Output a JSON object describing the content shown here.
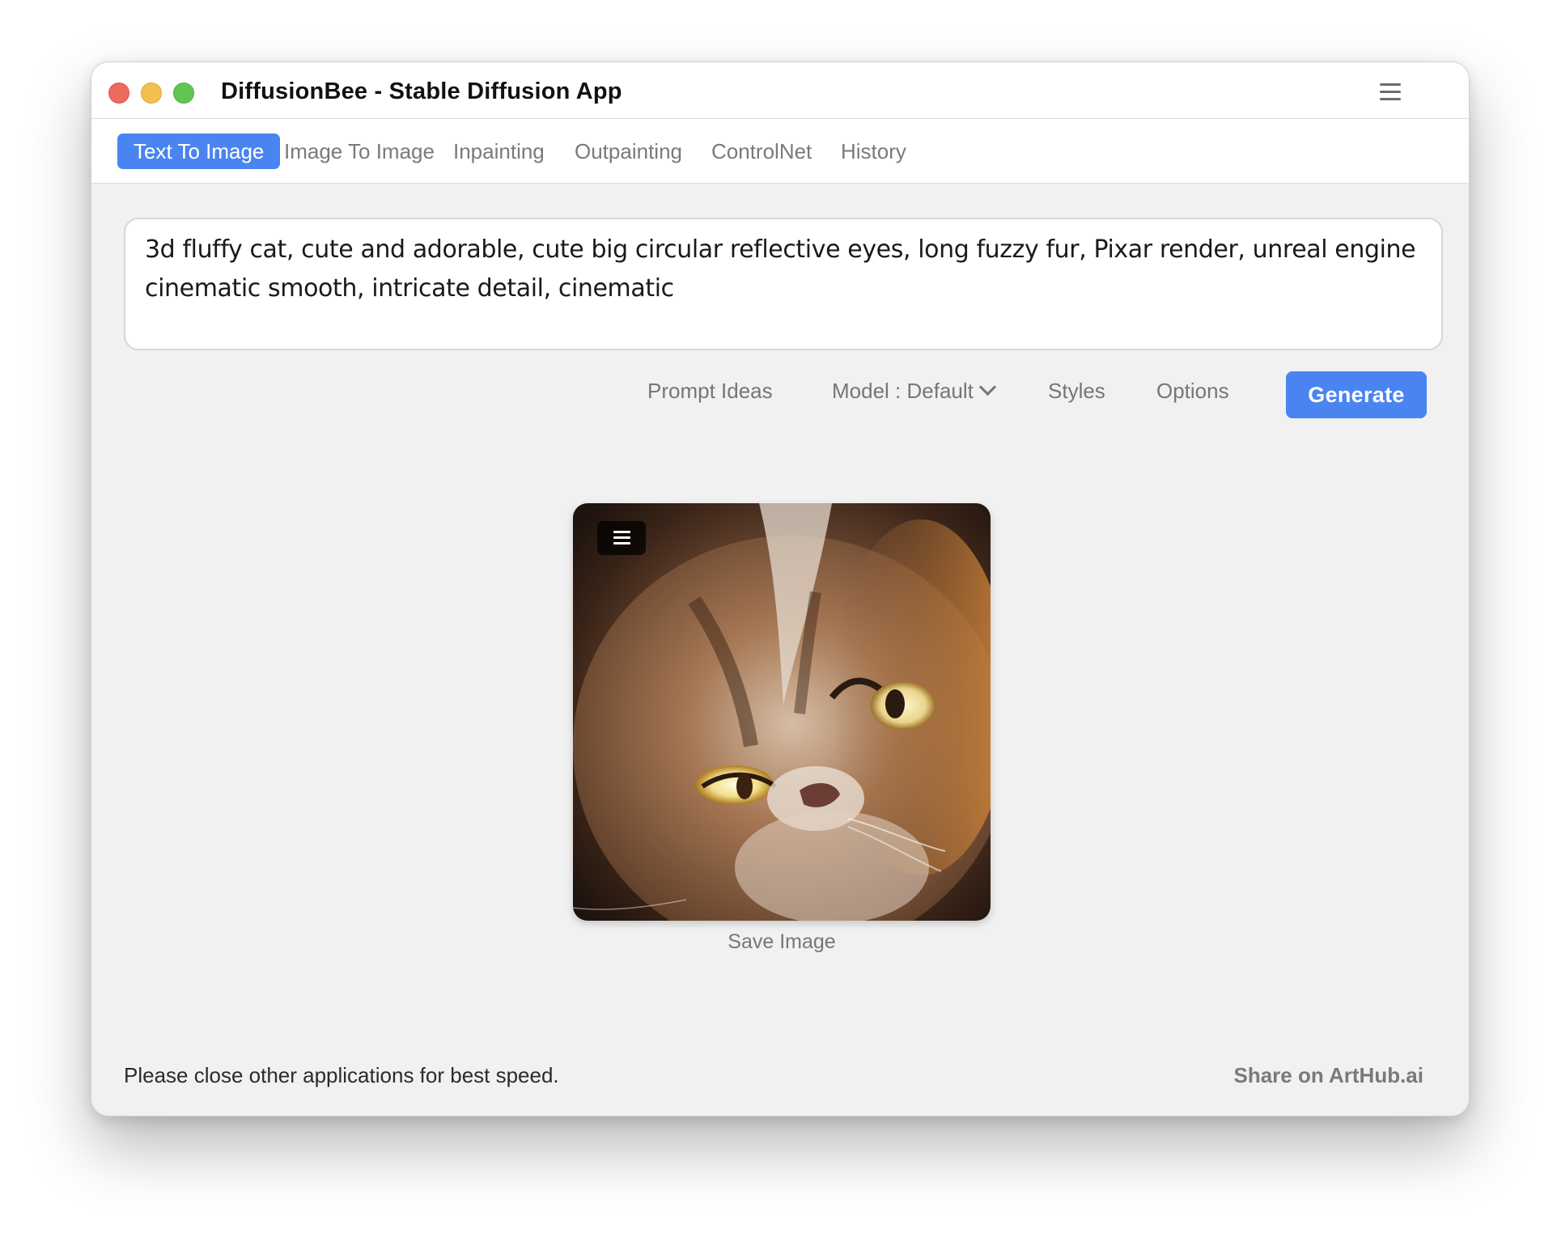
{
  "window": {
    "title": "DiffusionBee - Stable Diffusion App",
    "menu_icon": "hamburger-menu-icon"
  },
  "tabs": [
    {
      "label": "Text To Image",
      "active": true
    },
    {
      "label": "Image To Image",
      "active": false
    },
    {
      "label": "Inpainting",
      "active": false
    },
    {
      "label": "Outpainting",
      "active": false
    },
    {
      "label": "ControlNet",
      "active": false
    },
    {
      "label": "History",
      "active": false
    }
  ],
  "prompt": {
    "value": "3d fluffy cat, cute and adorable, cute big circular reflective eyes, long fuzzy fur, Pixar render, unreal engine cinematic smooth, intricate detail, cinematic"
  },
  "toolbar": {
    "prompt_ideas": "Prompt Ideas",
    "model": "Model : Default",
    "styles": "Styles",
    "options": "Options",
    "generate": "Generate"
  },
  "result": {
    "image_menu_icon": "hamburger-menu-icon",
    "save_label": "Save Image"
  },
  "footer": {
    "status": "Please close other applications for best speed.",
    "share": "Share on ArtHub.ai"
  },
  "colors": {
    "accent": "#4a84f0",
    "window_bg": "#f1f1f1"
  }
}
